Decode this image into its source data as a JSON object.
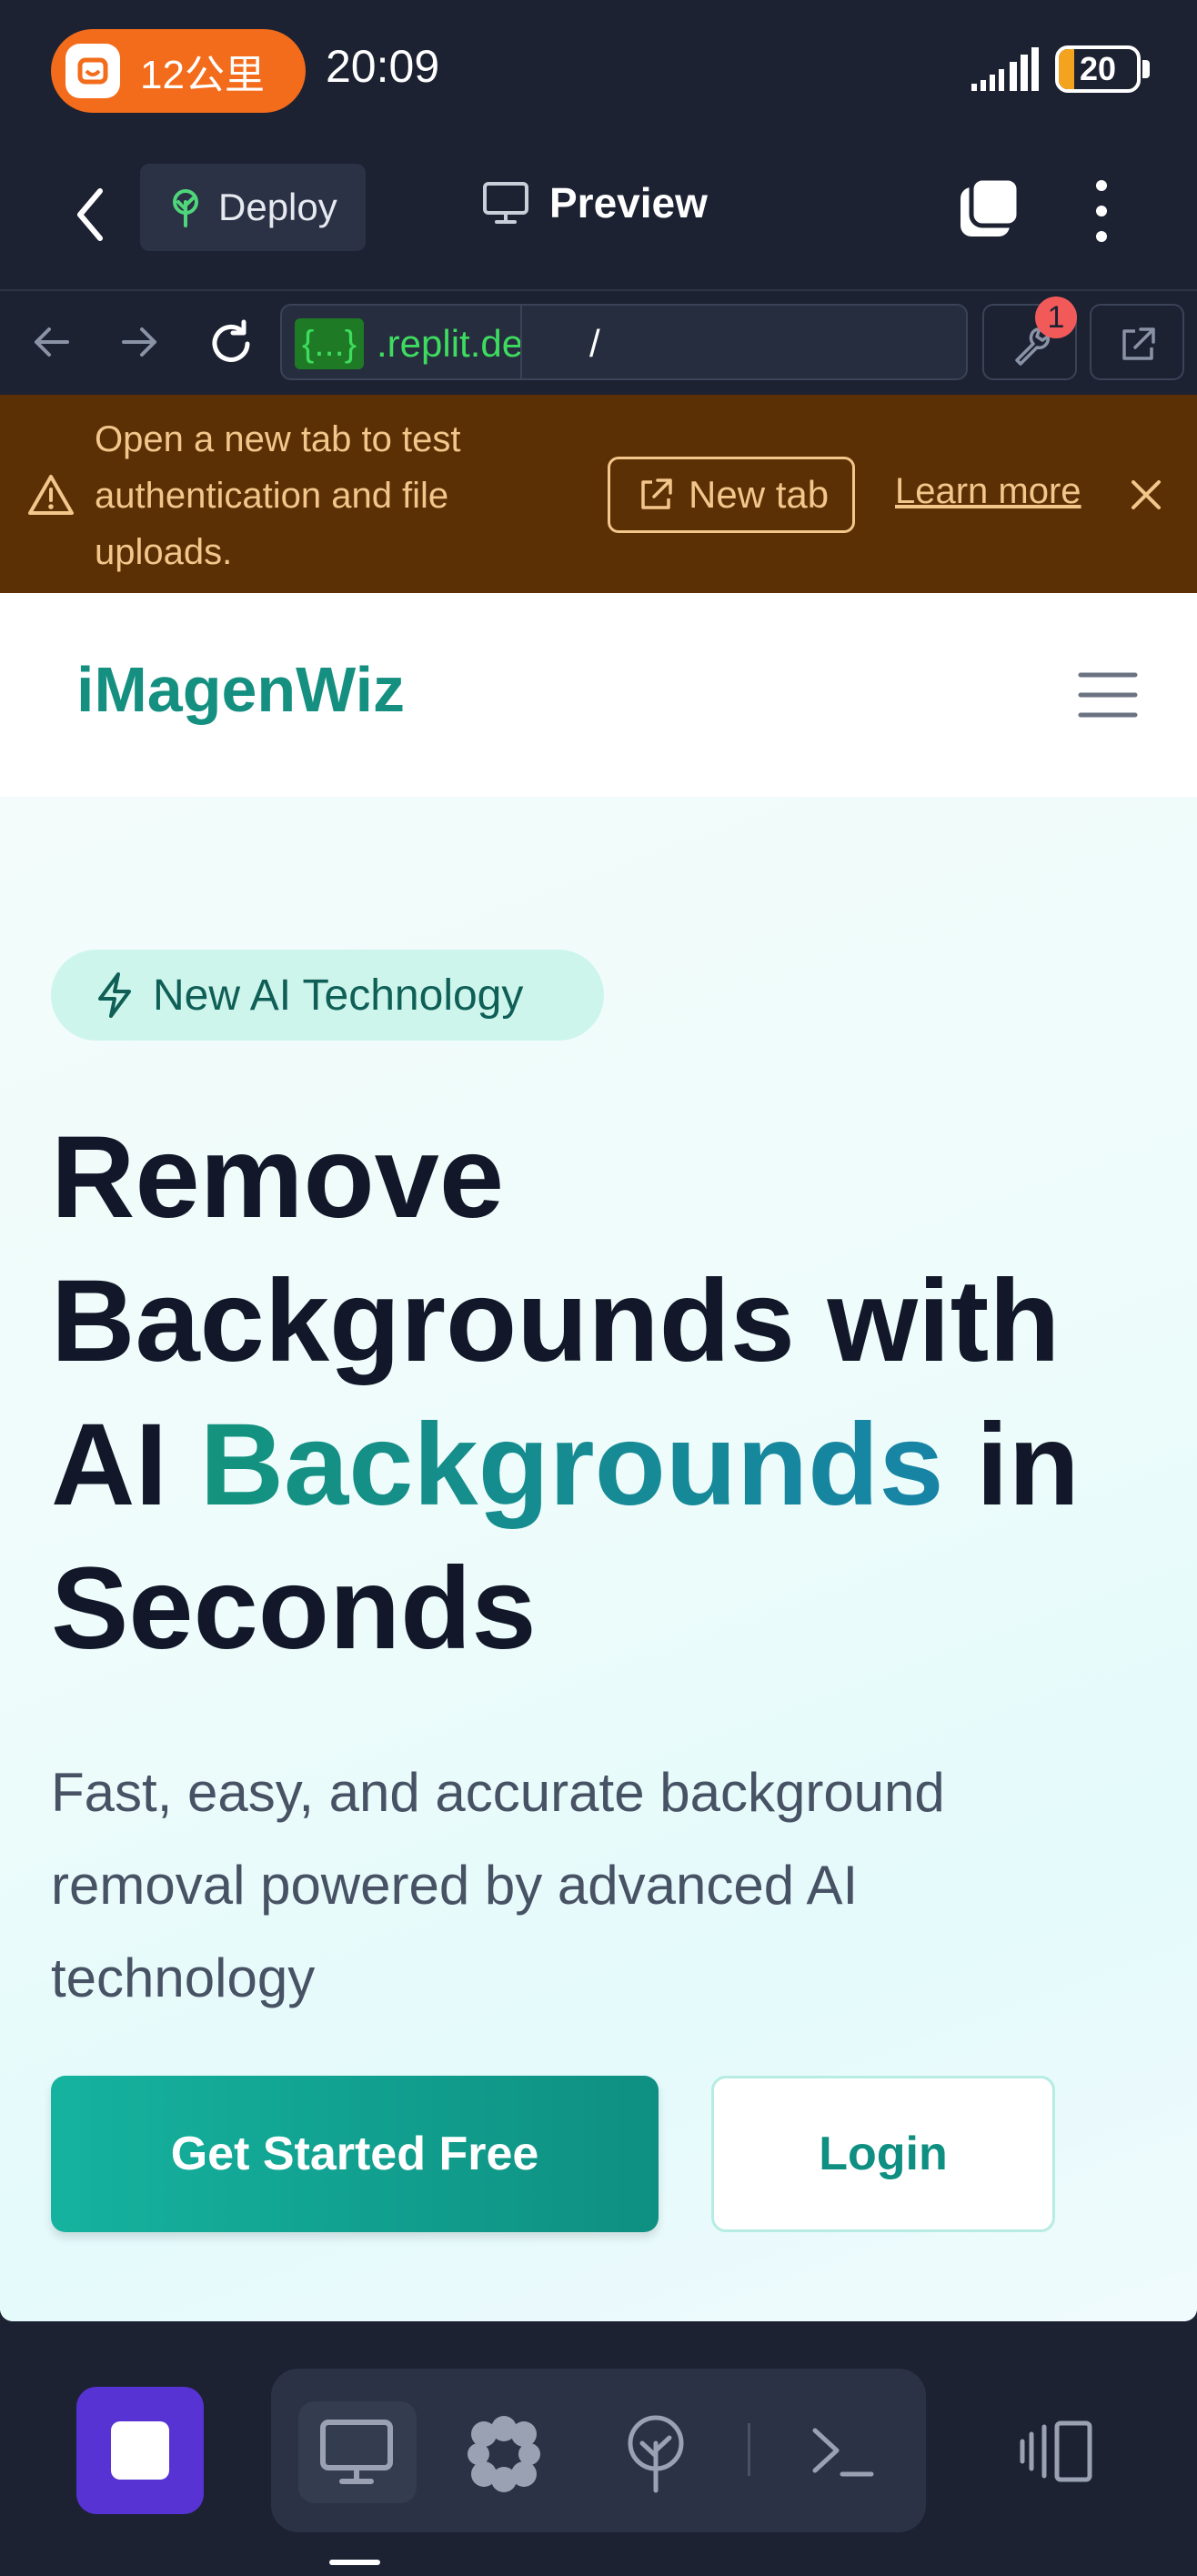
{
  "status_bar": {
    "ride_text": "12公里",
    "time": "20:09",
    "battery": "20",
    "battery_level_percent": 20
  },
  "topbar": {
    "deploy_label": "Deploy",
    "preview_label": "Preview"
  },
  "urlbar": {
    "url_prefix": "{...}",
    "url_host": ".replit.dev",
    "url_path": "/",
    "devtools_badge": "1"
  },
  "banner": {
    "message": "Open a new tab to test authentication and file uploads.",
    "new_tab_label": "New tab",
    "learn_more_label": "Learn more"
  },
  "site": {
    "logo": "iMagenWiz",
    "pill_label": "New AI Technology",
    "headline_part1": "Remove Backgrounds with AI ",
    "headline_accent": "Backgrounds",
    "headline_part2": " in Seconds",
    "subtext": "Fast, easy, and accurate background removal powered by advanced AI technology",
    "cta_primary": "Get Started Free",
    "cta_login": "Login"
  },
  "colors": {
    "brand_teal": "#148f80",
    "replit_stop": "#5733d3",
    "banner_bg": "#5c3005",
    "banner_text": "#f3c68b",
    "url_green": "#3ddc5f",
    "ride_orange": "#f36c1c"
  },
  "icons": {
    "back": "chevron-left-icon",
    "deploy": "deploy-tree-icon",
    "preview": "monitor-icon",
    "tabs": "tabs-icon",
    "menu": "kebab-icon",
    "nav_back": "arrow-left-icon",
    "nav_forward": "arrow-right-icon",
    "reload": "reload-icon",
    "devtools": "wrench-icon",
    "external": "external-link-icon",
    "warning": "warning-icon",
    "close": "close-icon",
    "hamburger": "hamburger-icon",
    "bolt": "bolt-icon"
  }
}
